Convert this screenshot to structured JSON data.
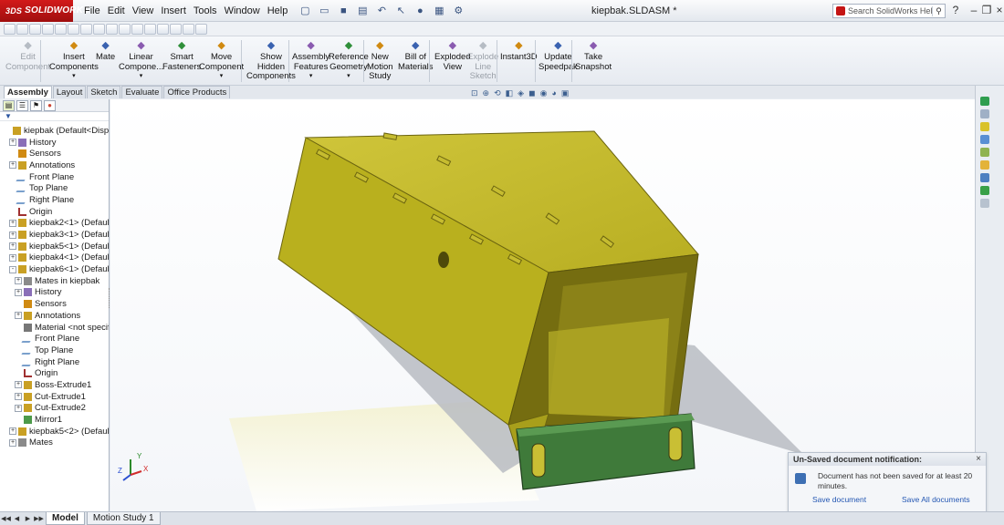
{
  "app": {
    "brand_prefix": "3DS",
    "brand": "SOLIDWORKS",
    "document_title": "kiepbak.SLDASM *"
  },
  "menu": [
    "File",
    "Edit",
    "View",
    "Insert",
    "Tools",
    "Window",
    "Help"
  ],
  "help_search": {
    "placeholder": "Search SolidWorks Help"
  },
  "command_manager": [
    {
      "label": "Edit\nComponent",
      "icon": "edit-component-icon",
      "disabled": true
    },
    {
      "label": "Insert\nComponents",
      "icon": "insert-components-icon",
      "dropdown": true
    },
    {
      "label": "Mate",
      "icon": "mate-icon"
    },
    {
      "label": "Linear\nCompone...",
      "icon": "linear-pattern-icon",
      "dropdown": true
    },
    {
      "label": "Smart\nFasteners",
      "icon": "smart-fasteners-icon"
    },
    {
      "label": "Move\nComponent",
      "icon": "move-component-icon",
      "dropdown": true
    },
    {
      "label": "Show\nHidden\nComponents",
      "icon": "show-hidden-icon"
    },
    {
      "label": "Assembly\nFeatures",
      "icon": "assembly-features-icon",
      "dropdown": true
    },
    {
      "label": "Reference\nGeometry",
      "icon": "reference-geometry-icon",
      "dropdown": true
    },
    {
      "label": "New\nMotion\nStudy",
      "icon": "motion-study-icon"
    },
    {
      "label": "Bill of\nMaterials",
      "icon": "bom-icon"
    },
    {
      "label": "Exploded\nView",
      "icon": "exploded-view-icon"
    },
    {
      "label": "Explode\nLine\nSketch",
      "icon": "explode-line-icon",
      "disabled": true
    },
    {
      "label": "Instant3D",
      "icon": "instant3d-icon"
    },
    {
      "label": "Update\nSpeedpak",
      "icon": "speedpak-icon"
    },
    {
      "label": "Take\nSnapshot",
      "icon": "snapshot-icon"
    }
  ],
  "tabs": [
    "Assembly",
    "Layout",
    "Sketch",
    "Evaluate",
    "Office Products"
  ],
  "tree": [
    {
      "label": "kiepbak  (Default<Displ",
      "indent": 0,
      "icon": "assembly-icon",
      "exp": ""
    },
    {
      "label": "History",
      "indent": 1,
      "icon": "history-icon",
      "exp": "+"
    },
    {
      "label": "Sensors",
      "indent": 1,
      "icon": "sensors-icon",
      "exp": ""
    },
    {
      "label": "Annotations",
      "indent": 1,
      "icon": "annotations-icon",
      "exp": "+"
    },
    {
      "label": "Front Plane",
      "indent": 1,
      "icon": "plane-icon",
      "exp": ""
    },
    {
      "label": "Top Plane",
      "indent": 1,
      "icon": "plane-icon",
      "exp": ""
    },
    {
      "label": "Right Plane",
      "indent": 1,
      "icon": "plane-icon",
      "exp": ""
    },
    {
      "label": "Origin",
      "indent": 1,
      "icon": "origin-icon",
      "exp": ""
    },
    {
      "label": "kiepbak2<1> (Defaul",
      "indent": 1,
      "icon": "part-icon",
      "exp": "+"
    },
    {
      "label": "kiepbak3<1> (Defaul",
      "indent": 1,
      "icon": "part-icon",
      "exp": "+"
    },
    {
      "label": "kiepbak5<1> (Defaul",
      "indent": 1,
      "icon": "part-icon",
      "exp": "+"
    },
    {
      "label": "kiepbak4<1> (Defaul",
      "indent": 1,
      "icon": "part-icon",
      "exp": "+"
    },
    {
      "label": "kiepbak6<1> (Defaul",
      "indent": 1,
      "icon": "part-icon",
      "exp": "-"
    },
    {
      "label": "Mates in kiepbak",
      "indent": 2,
      "icon": "mates-icon",
      "exp": "+"
    },
    {
      "label": "History",
      "indent": 2,
      "icon": "history-icon",
      "exp": "+"
    },
    {
      "label": "Sensors",
      "indent": 2,
      "icon": "sensors-icon",
      "exp": ""
    },
    {
      "label": "Annotations",
      "indent": 2,
      "icon": "annotations-icon",
      "exp": "+"
    },
    {
      "label": "Material <not specifi",
      "indent": 2,
      "icon": "material-icon",
      "exp": ""
    },
    {
      "label": "Front Plane",
      "indent": 2,
      "icon": "plane-icon",
      "exp": ""
    },
    {
      "label": "Top Plane",
      "indent": 2,
      "icon": "plane-icon",
      "exp": ""
    },
    {
      "label": "Right Plane",
      "indent": 2,
      "icon": "plane-icon",
      "exp": ""
    },
    {
      "label": "Origin",
      "indent": 2,
      "icon": "origin-icon",
      "exp": ""
    },
    {
      "label": "Boss-Extrude1",
      "indent": 2,
      "icon": "extrude-icon",
      "exp": "+"
    },
    {
      "label": "Cut-Extrude1",
      "indent": 2,
      "icon": "cut-extrude-icon",
      "exp": "+"
    },
    {
      "label": "Cut-Extrude2",
      "indent": 2,
      "icon": "cut-extrude-icon",
      "exp": "+"
    },
    {
      "label": "Mirror1",
      "indent": 2,
      "icon": "mirror-icon",
      "exp": ""
    },
    {
      "label": "kiepbak5<2> (Defaul",
      "indent": 1,
      "icon": "part-icon",
      "exp": "+"
    },
    {
      "label": "Mates",
      "indent": 1,
      "icon": "mates-icon",
      "exp": "+"
    }
  ],
  "bottom_tabs": [
    "Model",
    "Motion Study 1"
  ],
  "notification": {
    "title": "Un-Saved document notification:",
    "message": "Document has not been saved for at least 20 minutes.",
    "link_save": "Save document",
    "link_save_all": "Save All documents"
  },
  "triad": {
    "x": "X",
    "y": "Y",
    "z": "Z"
  },
  "colors": {
    "box": "#bcb22a",
    "handle": "#3f7a3a",
    "brand_red": "#c41414"
  }
}
